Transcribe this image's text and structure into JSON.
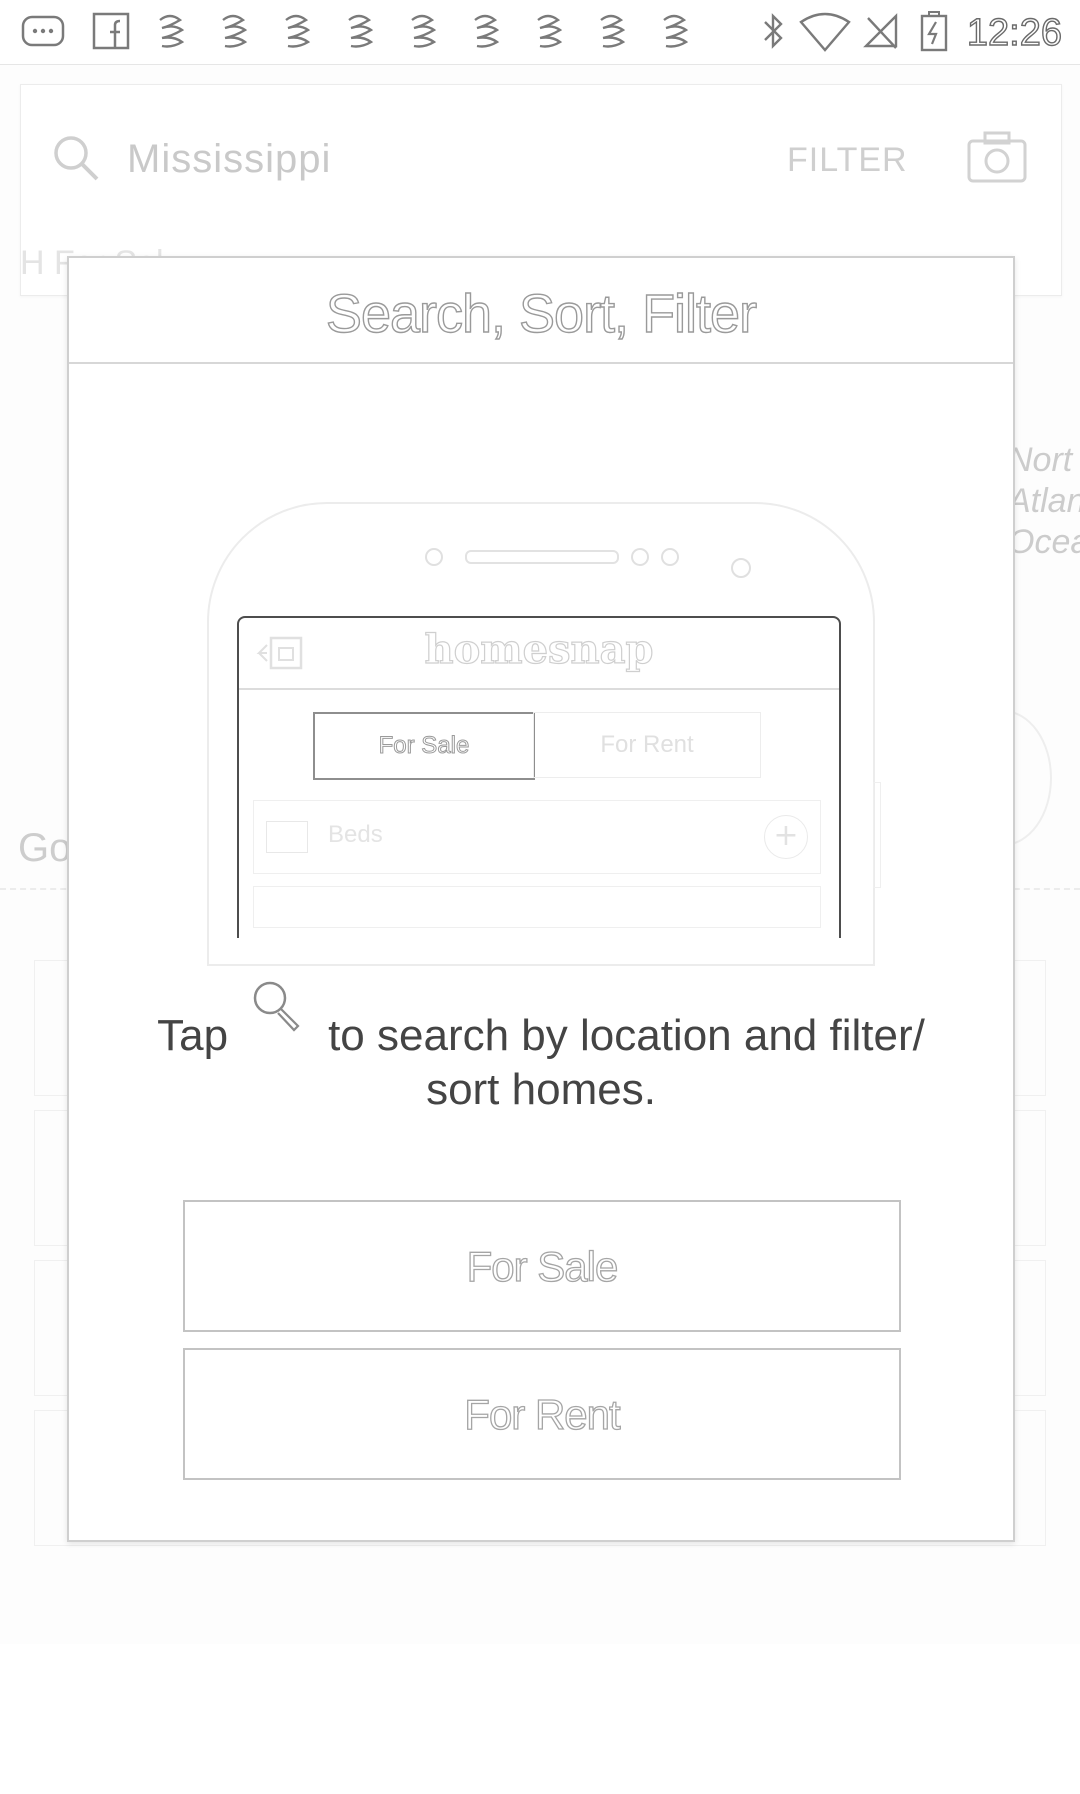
{
  "status_bar": {
    "time": "12:26",
    "left_icons": [
      "more-icon",
      "facebook-icon",
      "notification-icon",
      "notification-icon",
      "notification-icon",
      "notification-icon",
      "notification-icon",
      "notification-icon",
      "notification-icon",
      "notification-icon",
      "notification-icon"
    ],
    "right_icons": [
      "bluetooth-icon",
      "wifi-icon",
      "no-signal-icon",
      "battery-charging-icon"
    ]
  },
  "search": {
    "query": "Mississippi",
    "filter_label": "FILTER"
  },
  "background": {
    "tab_partial": "H        For Sal",
    "map_label": "Nort\nAtlan\nOcea",
    "google_partial": "Go"
  },
  "dialog": {
    "title": "Search, Sort, Filter",
    "illustration": {
      "logo": "homesnap",
      "tab_sale": "For Sale",
      "tab_rent": "For Rent",
      "row_label": "Beds",
      "row_plus": "+"
    },
    "instruction_prefix": "Tap",
    "instruction_suffix": "to search by location and filter/",
    "instruction_line2": "sort homes.",
    "button_sale": "For Sale",
    "button_rent": "For Rent"
  }
}
